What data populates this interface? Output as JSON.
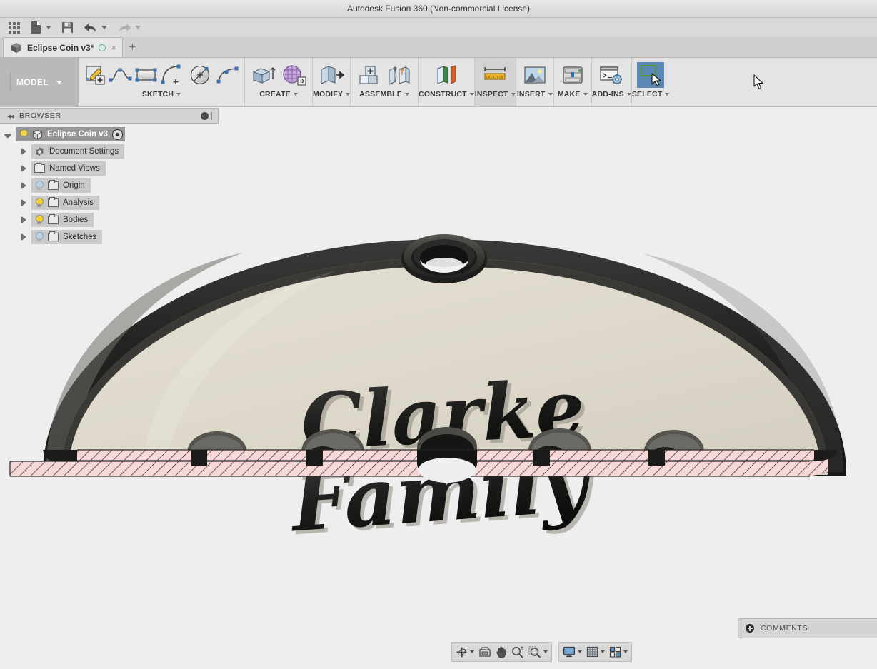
{
  "window": {
    "title": "Autodesk Fusion 360 (Non-commercial License)"
  },
  "quick_access": {
    "items": [
      {
        "name": "app-menu-grid",
        "label": "",
        "icon": "grid-icon",
        "has_caret": false
      },
      {
        "name": "new-file",
        "label": "",
        "icon": "file-icon",
        "has_caret": true
      },
      {
        "name": "save",
        "label": "",
        "icon": "save-icon",
        "has_caret": false
      },
      {
        "name": "undo",
        "label": "",
        "icon": "undo-arrow-icon",
        "has_caret": true
      },
      {
        "name": "redo",
        "label": "",
        "icon": "redo-arrow-icon",
        "has_caret": true
      }
    ]
  },
  "tabs": {
    "open": [
      {
        "label": "Eclipse Coin v3*",
        "icon": "cube-icon",
        "unsaved": true,
        "close": "×"
      }
    ],
    "add_label": "+"
  },
  "ribbon": {
    "workspace": {
      "label": "MODEL",
      "caret": "▾"
    },
    "panels": [
      {
        "name": "sketch",
        "title": "SKETCH",
        "highlighted": false,
        "tools": [
          "create-sketch-icon",
          "spline-icon",
          "rectangle-icon",
          "arc-icon",
          "circle-icon",
          "fit-curve-icon"
        ]
      },
      {
        "name": "create",
        "title": "CREATE",
        "highlighted": false,
        "tools": [
          "extrude-icon",
          "mesh-icon"
        ]
      },
      {
        "name": "modify",
        "title": "MODIFY",
        "highlighted": false,
        "tools": [
          "press-pull-icon"
        ]
      },
      {
        "name": "assemble",
        "title": "ASSEMBLE",
        "highlighted": false,
        "tools": [
          "new-component-icon",
          "joint-icon"
        ]
      },
      {
        "name": "construct",
        "title": "CONSTRUCT",
        "highlighted": false,
        "tools": [
          "offset-plane-icon"
        ]
      },
      {
        "name": "inspect",
        "title": "INSPECT",
        "highlighted": true,
        "tools": [
          "measure-ruler-icon"
        ]
      },
      {
        "name": "insert",
        "title": "INSERT",
        "highlighted": false,
        "tools": [
          "insert-image-icon"
        ]
      },
      {
        "name": "make",
        "title": "MAKE",
        "highlighted": false,
        "tools": [
          "3d-print-icon"
        ]
      },
      {
        "name": "add-ins",
        "title": "ADD-INS",
        "highlighted": false,
        "tools": [
          "scripts-addins-icon"
        ]
      },
      {
        "name": "select",
        "title": "SELECT",
        "highlighted": false,
        "tools": [
          "select-window-icon"
        ]
      }
    ]
  },
  "browser": {
    "header": {
      "title": "BROWSER",
      "collapse_icon": "collapse-left-icon",
      "minimize_icon": "minus-circle-icon"
    },
    "root": {
      "label": "Eclipse Coin v3",
      "visible": true,
      "icon": "cube-icon",
      "state_icon": "radio-dot-icon"
    },
    "items": [
      {
        "label": "Document Settings",
        "icon": "gear-icon",
        "bulb": "none"
      },
      {
        "label": "Named Views",
        "icon": "folder-icon",
        "bulb": "none"
      },
      {
        "label": "Origin",
        "icon": "folder-icon",
        "bulb": "off"
      },
      {
        "label": "Analysis",
        "icon": "folder-icon",
        "bulb": "on"
      },
      {
        "label": "Bodies",
        "icon": "folder-icon",
        "bulb": "on"
      },
      {
        "label": "Sketches",
        "icon": "folder-icon",
        "bulb": "off"
      }
    ]
  },
  "model": {
    "engraved_text_line1": "Clarke",
    "engraved_text_line2": "Family",
    "colors": {
      "face_cream": "#ded9cc",
      "rim_dark": "#2a2a28",
      "section_hatch_fill": "#f7d7d7",
      "section_hatch_line": "#1a1a1a",
      "canvas_bg": "#eeeeee"
    }
  },
  "comments": {
    "label": "COMMENTS",
    "icon": "plus-circle-icon"
  },
  "navbar": {
    "groups": [
      {
        "name": "view-tools",
        "buttons": [
          {
            "name": "orbit",
            "icon": "orbit-icon",
            "caret": true
          },
          {
            "name": "look-at",
            "icon": "look-at-icon",
            "caret": false
          },
          {
            "name": "pan",
            "icon": "hand-pan-icon",
            "caret": false
          },
          {
            "name": "zoom",
            "icon": "zoom-magnifier-icon",
            "caret": false
          },
          {
            "name": "zoom-window",
            "icon": "zoom-window-icon",
            "caret": true
          }
        ]
      },
      {
        "name": "display-tools",
        "buttons": [
          {
            "name": "display-settings",
            "icon": "monitor-icon",
            "caret": true
          },
          {
            "name": "grid-snaps",
            "icon": "grid-table-icon",
            "caret": true
          },
          {
            "name": "viewports",
            "icon": "viewports-icon",
            "caret": true
          }
        ]
      }
    ]
  }
}
